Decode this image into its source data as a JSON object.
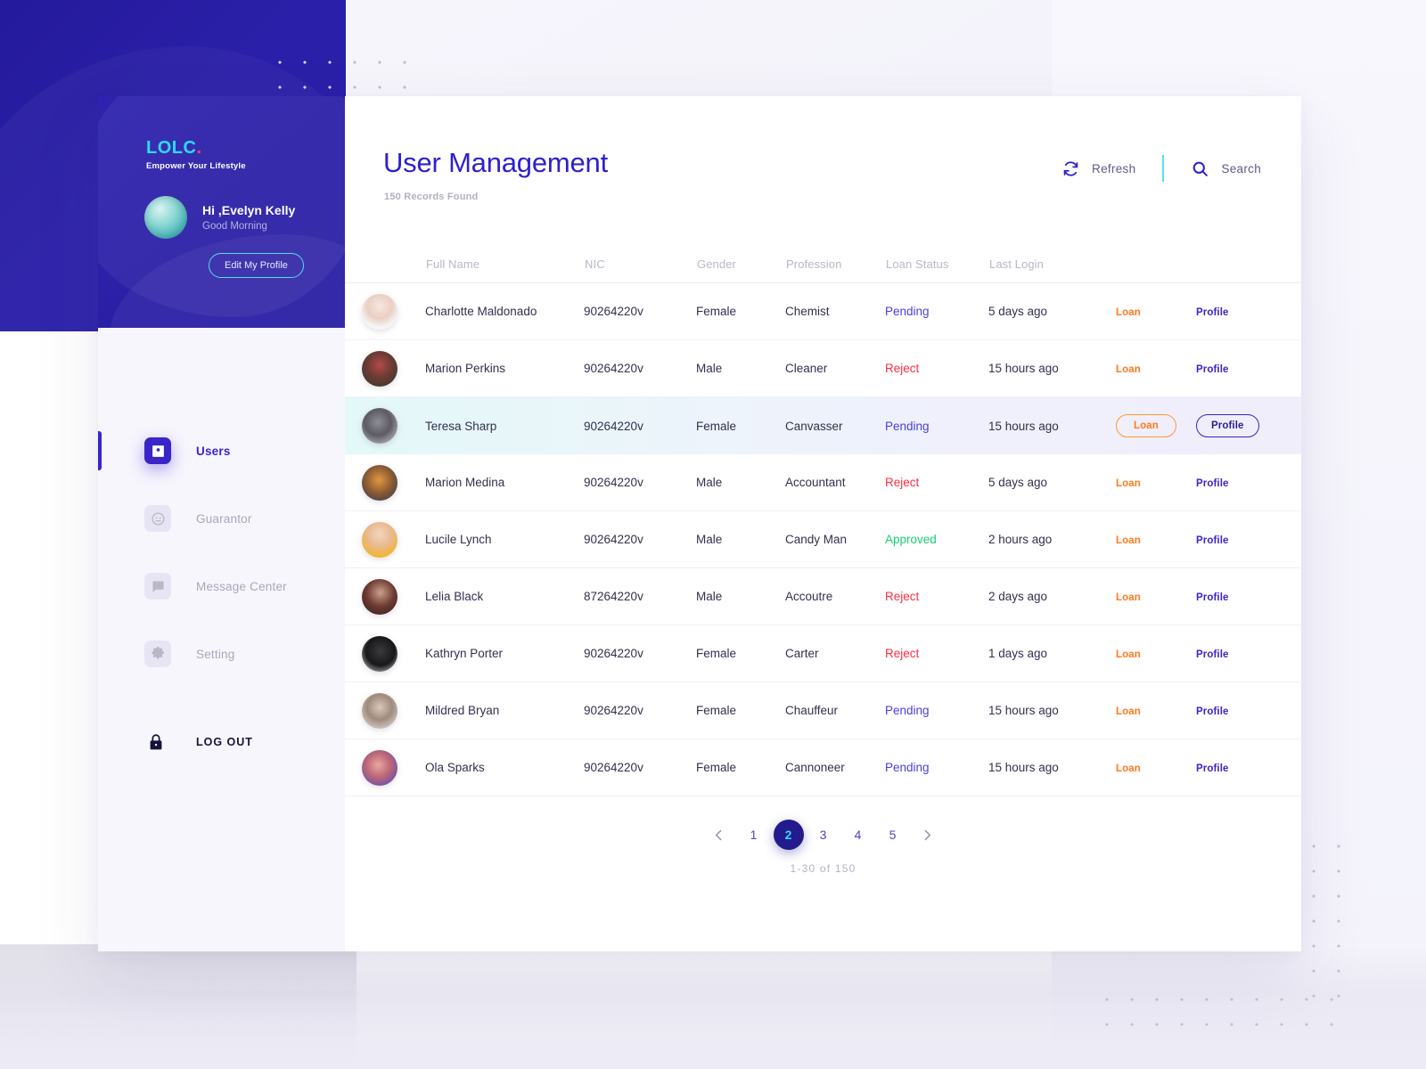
{
  "brand": {
    "logo_text": "LOLC",
    "logo_dot": ".",
    "tagline": "Empower Your Lifestyle"
  },
  "user": {
    "greeting": "Hi ,Evelyn Kelly",
    "time_of_day": "Good Morning",
    "edit_button": "Edit My Profile",
    "avatar_icon": "user-avatar"
  },
  "sidebar": {
    "items": [
      {
        "label": "Users",
        "icon": "contact-card-icon",
        "active": true
      },
      {
        "label": "Guarantor",
        "icon": "face-circle-icon",
        "active": false
      },
      {
        "label": "Message Center",
        "icon": "chat-bubble-icon",
        "active": false
      },
      {
        "label": "Setting",
        "icon": "gear-icon",
        "active": false
      }
    ],
    "logout": {
      "label": "LOG OUT",
      "icon": "lock-icon"
    }
  },
  "header": {
    "title": "User Management",
    "records_found": "150 Records Found",
    "refresh_label": "Refresh",
    "refresh_icon": "refresh-icon",
    "search_label": "Search",
    "search_icon": "search-icon"
  },
  "table": {
    "columns": [
      "Full Name",
      "NIC",
      "Gender",
      "Profession",
      "Loan Status",
      "Last Login"
    ],
    "action_labels": {
      "loan": "Loan",
      "profile": "Profile"
    },
    "rows": [
      {
        "name": "Charlotte Maldonado",
        "nic": "90264220v",
        "gender": "Female",
        "profession": "Chemist",
        "status": "Pending",
        "status_kind": "pending",
        "last_login": "5 days ago",
        "loan": "Loan",
        "profile": "Profile",
        "highlighted": false
      },
      {
        "name": "Marion Perkins",
        "nic": "90264220v",
        "gender": "Male",
        "profession": "Cleaner",
        "status": "Reject",
        "status_kind": "reject",
        "last_login": "15 hours ago",
        "loan": "Loan",
        "profile": "Profile",
        "highlighted": false
      },
      {
        "name": "Teresa Sharp",
        "nic": "90264220v",
        "gender": "Female",
        "profession": "Canvasser",
        "status": "Pending",
        "status_kind": "pending",
        "last_login": "15 hours ago",
        "loan": "Loan",
        "profile": "Profile",
        "highlighted": true
      },
      {
        "name": "Marion Medina",
        "nic": "90264220v",
        "gender": "Male",
        "profession": "Accountant",
        "status": "Reject",
        "status_kind": "reject",
        "last_login": "5 days ago",
        "loan": "Loan",
        "profile": "Profile",
        "highlighted": false
      },
      {
        "name": "Lucile Lynch",
        "nic": "90264220v",
        "gender": "Male",
        "profession": "Candy Man",
        "status": "Approved",
        "status_kind": "approved",
        "last_login": "2 hours ago",
        "loan": "Loan",
        "profile": "Profile",
        "highlighted": false
      },
      {
        "name": "Lelia Black",
        "nic": "87264220v",
        "gender": "Male",
        "profession": "Accoutre",
        "status": "Reject",
        "status_kind": "reject",
        "last_login": "2 days ago",
        "loan": "Loan",
        "profile": "Profile",
        "highlighted": false
      },
      {
        "name": "Kathryn Porter",
        "nic": "90264220v",
        "gender": "Female",
        "profession": "Carter",
        "status": "Reject",
        "status_kind": "reject",
        "last_login": "1 days ago",
        "loan": "Loan",
        "profile": "Profile",
        "highlighted": false
      },
      {
        "name": "Mildred Bryan",
        "nic": "90264220v",
        "gender": "Female",
        "profession": "Chauffeur",
        "status": "Pending",
        "status_kind": "pending",
        "last_login": "15 hours ago",
        "loan": "Loan",
        "profile": "Profile",
        "highlighted": false
      },
      {
        "name": "Ola Sparks",
        "nic": "90264220v",
        "gender": "Female",
        "profession": "Cannoneer",
        "status": "Pending",
        "status_kind": "pending",
        "last_login": "15 hours ago",
        "loan": "Loan",
        "profile": "Profile",
        "highlighted": false
      }
    ]
  },
  "pagination": {
    "prev_icon": "chevron-left-icon",
    "next_icon": "chevron-right-icon",
    "pages": [
      "1",
      "2",
      "3",
      "4",
      "5"
    ],
    "active_page": "2",
    "range_info": "1-30 of 150"
  },
  "colors": {
    "brand_purple": "#2d1fd0",
    "deep_purple": "#231a8e",
    "cyan": "#2fd9f2",
    "orange": "#ff7a1c",
    "pending": "#4a3ee0",
    "reject": "#ff2d3f",
    "approved": "#17cf6f",
    "logo_dot": "#ff3d6e"
  }
}
